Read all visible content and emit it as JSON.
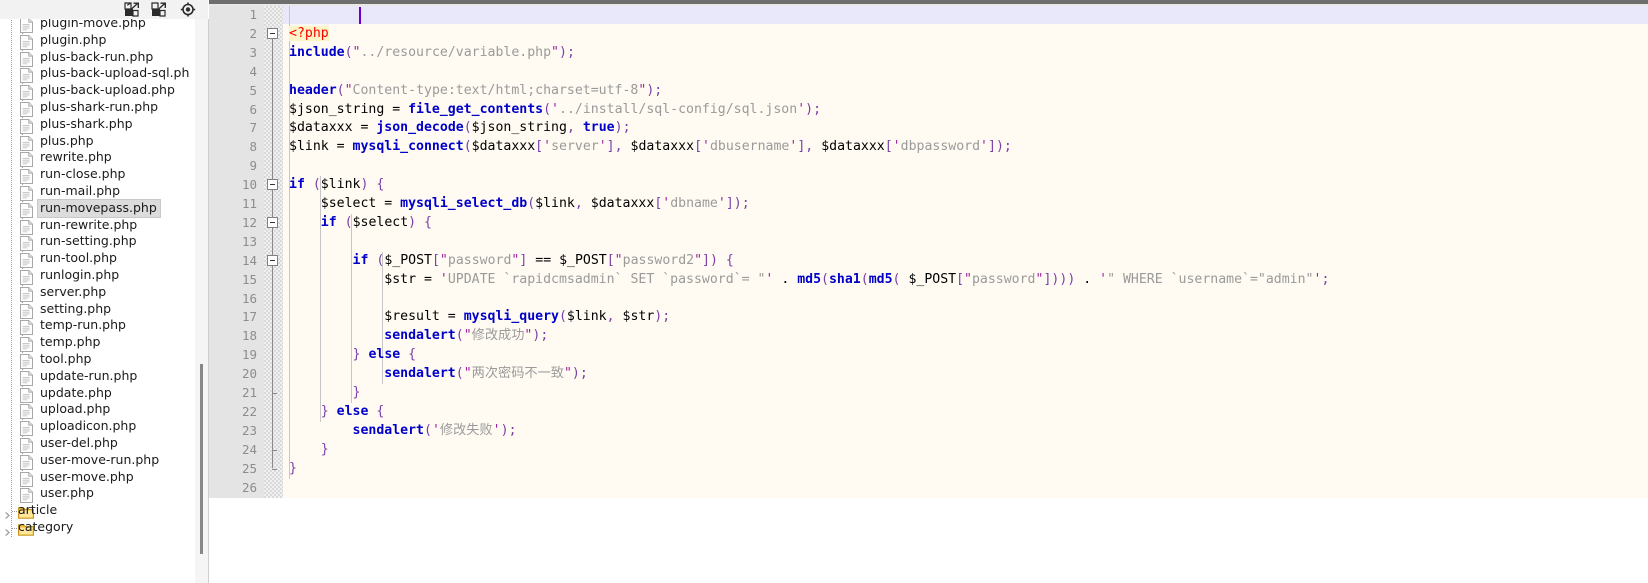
{
  "tree_toolbar": {
    "icons": [
      {
        "name": "expand-all-icon",
        "title": "Expand All"
      },
      {
        "name": "collapse-all-icon",
        "title": "Collapse All"
      },
      {
        "name": "locate-current-file-icon",
        "title": "Locate Current File"
      }
    ]
  },
  "file_tree": {
    "selected": "run-movepass.php",
    "items": [
      {
        "label": "plugin-move.php",
        "type": "file"
      },
      {
        "label": "plugin.php",
        "type": "file"
      },
      {
        "label": "plus-back-run.php",
        "type": "file"
      },
      {
        "label": "plus-back-upload-sql.ph",
        "type": "file"
      },
      {
        "label": "plus-back-upload.php",
        "type": "file"
      },
      {
        "label": "plus-shark-run.php",
        "type": "file"
      },
      {
        "label": "plus-shark.php",
        "type": "file"
      },
      {
        "label": "plus.php",
        "type": "file"
      },
      {
        "label": "rewrite.php",
        "type": "file"
      },
      {
        "label": "run-close.php",
        "type": "file"
      },
      {
        "label": "run-mail.php",
        "type": "file"
      },
      {
        "label": "run-movepass.php",
        "type": "file"
      },
      {
        "label": "run-rewrite.php",
        "type": "file"
      },
      {
        "label": "run-setting.php",
        "type": "file"
      },
      {
        "label": "run-tool.php",
        "type": "file"
      },
      {
        "label": "runlogin.php",
        "type": "file"
      },
      {
        "label": "server.php",
        "type": "file"
      },
      {
        "label": "setting.php",
        "type": "file"
      },
      {
        "label": "temp-run.php",
        "type": "file"
      },
      {
        "label": "temp.php",
        "type": "file"
      },
      {
        "label": "tool.php",
        "type": "file"
      },
      {
        "label": "update-run.php",
        "type": "file"
      },
      {
        "label": "update.php",
        "type": "file"
      },
      {
        "label": "upload.php",
        "type": "file"
      },
      {
        "label": "uploadicon.php",
        "type": "file"
      },
      {
        "label": "user-del.php",
        "type": "file"
      },
      {
        "label": "user-move-run.php",
        "type": "file"
      },
      {
        "label": "user-move.php",
        "type": "file"
      },
      {
        "label": "user.php",
        "type": "file"
      },
      {
        "label": "article",
        "type": "folder",
        "collapsed": true
      },
      {
        "label": "category",
        "type": "folder",
        "collapsed": true
      }
    ]
  },
  "editor": {
    "language": "php",
    "current_line": 1,
    "line_count": 26,
    "line_numbers": [
      "1",
      "2",
      "3",
      "4",
      "5",
      "6",
      "7",
      "8",
      "9",
      "10",
      "11",
      "12",
      "13",
      "14",
      "15",
      "16",
      "17",
      "18",
      "19",
      "20",
      "21",
      "22",
      "23",
      "24",
      "25",
      "26"
    ],
    "fold_markers": [
      {
        "line": 2,
        "state": "expanded"
      },
      {
        "line": 10,
        "state": "expanded"
      },
      {
        "line": 12,
        "state": "expanded"
      },
      {
        "line": 14,
        "state": "expanded"
      }
    ],
    "lines": [
      "",
      "<?php",
      "include(\"../resource/variable.php\");",
      "",
      "header(\"Content-type:text/html;charset=utf-8\");",
      "$json_string = file_get_contents('../install/sql-config/sql.json');",
      "$dataxxx = json_decode($json_string, true);",
      "$link = mysqli_connect($dataxxx['server'], $dataxxx['dbusername'], $dataxxx['dbpassword']);",
      "",
      "if ($link) {",
      "    $select = mysqli_select_db($link, $dataxxx['dbname']);",
      "    if ($select) {",
      "",
      "        if ($_POST[\"password\"] == $_POST[\"password2\"]) {",
      "            $str = 'UPDATE `rapidcmsadmin` SET `password`= \"' . md5(sha1(md5( $_POST[\"password\"]))) . '\" WHERE `username`=\"admin\"';",
      "",
      "            $result = mysqli_query($link, $str);",
      "            sendalert(\"修改成功\");",
      "        } else {",
      "            sendalert(\"两次密码不一致\");",
      "        }",
      "    } else {",
      "        sendalert('修改失败');",
      "    }",
      "}",
      ""
    ]
  },
  "colors": {
    "editor_background": "#fffbf2",
    "gutter_background": "#e4e4e4",
    "line_number": "#8d8d8d",
    "current_line_highlight": "#e8e8fa",
    "keyword": "#0000c8",
    "string": "#9a9a9a",
    "quote": "#a020a0",
    "php_tag": "#ff0000",
    "php_tag_background": "#fdf5c8",
    "selection": "#dcdcdc",
    "folder_icon": "#f5c342"
  }
}
